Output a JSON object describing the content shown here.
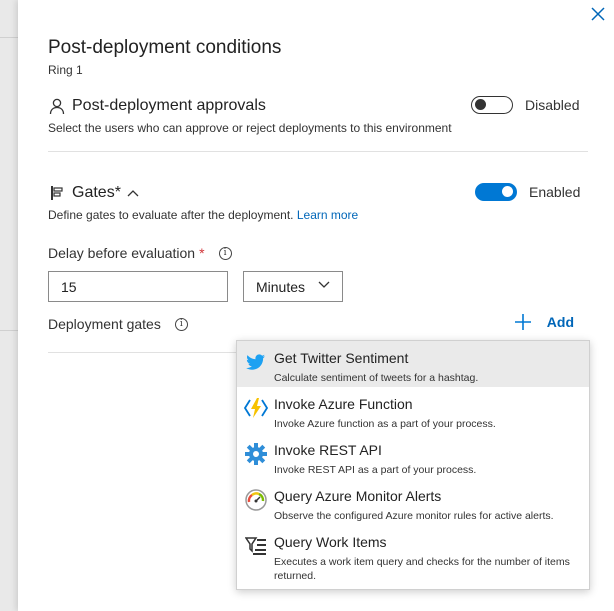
{
  "dialog": {
    "title": "Post-deployment conditions",
    "subtitle": "Ring 1"
  },
  "approvals": {
    "title": "Post-deployment approvals",
    "description": "Select the users who can approve or reject deployments to this environment",
    "toggle_label": "Disabled",
    "enabled": false
  },
  "gates": {
    "title": "Gates*",
    "description": "Define gates to evaluate after the deployment.",
    "learn_more": "Learn more",
    "toggle_label": "Enabled",
    "enabled": true
  },
  "delay": {
    "label": "Delay before evaluation",
    "required_mark": "*",
    "value": "15",
    "unit": "Minutes"
  },
  "deployment_gates": {
    "label": "Deployment gates",
    "add_label": "Add"
  },
  "gate_options": [
    {
      "title": "Get Twitter Sentiment",
      "desc": "Calculate sentiment of tweets for a hashtag.",
      "icon": "twitter-icon",
      "highlighted": true
    },
    {
      "title": "Invoke Azure Function",
      "desc": "Invoke Azure function as a part of your process.",
      "icon": "azure-function-icon"
    },
    {
      "title": "Invoke REST API",
      "desc": "Invoke REST API as a part of your process.",
      "icon": "gear-icon"
    },
    {
      "title": "Query Azure Monitor Alerts",
      "desc": "Observe the configured Azure monitor rules for active alerts.",
      "icon": "monitor-gauge-icon"
    },
    {
      "title": "Query Work Items",
      "desc": "Executes a work item query and checks for the number of items returned.",
      "icon": "work-items-query-icon"
    }
  ],
  "colors": {
    "accent": "#0078d4",
    "link": "#0066b8",
    "required": "#d13438"
  }
}
